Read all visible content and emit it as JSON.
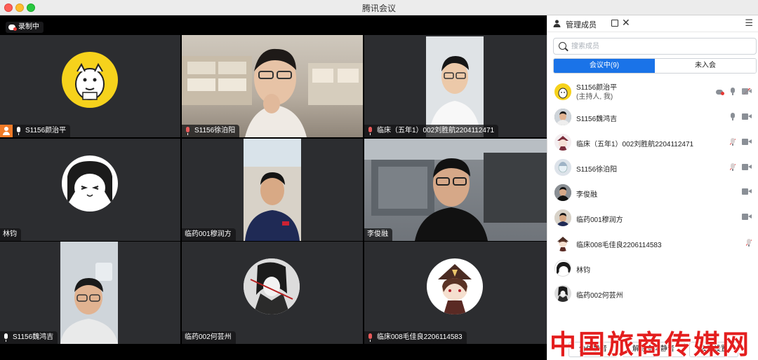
{
  "window": {
    "title": "腾讯会议"
  },
  "recording": {
    "label": "录制中"
  },
  "tiles": [
    {
      "name": "S1156颜治平",
      "host": true,
      "mic": "on"
    },
    {
      "name": "S1156徐泊阳",
      "mic": "muted"
    },
    {
      "name": "临床（五年1）002刘胜航2204112471",
      "mic": "muted"
    },
    {
      "name": "林钧"
    },
    {
      "name": "临药001穆润方"
    },
    {
      "name": "李俊融"
    },
    {
      "name": "S1156魏鸿吉",
      "mic": "on"
    },
    {
      "name": "临药002何芸州"
    },
    {
      "name": "临床008毛佳良2206114583",
      "mic": "muted"
    }
  ],
  "panel": {
    "title": "管理成员",
    "search_placeholder": "搜索成员",
    "tab_in_meeting": "会议中(9)",
    "tab_not_joined": "未入会",
    "members": [
      {
        "name": "S1156颜治平",
        "sub": "(主持人, 我)",
        "icons": [
          "cloud-record",
          "mic-on",
          "camera-off"
        ]
      },
      {
        "name": "S1156魏鸿吉",
        "icons": [
          "mic-on",
          "camera-on"
        ]
      },
      {
        "name": "临床（五年1）002刘胜航2204112471",
        "icons": [
          "mic-muted",
          "camera-on"
        ]
      },
      {
        "name": "S1156徐泊阳",
        "icons": [
          "mic-muted",
          "camera-on"
        ]
      },
      {
        "name": "李俊融",
        "icons": [
          "camera-on"
        ]
      },
      {
        "name": "临药001穆润方",
        "icons": [
          "camera-on"
        ]
      },
      {
        "name": "临床008毛佳良2206114583",
        "icons": [
          "mic-muted"
        ]
      },
      {
        "name": "林钧",
        "icons": []
      },
      {
        "name": "临药002何芸州",
        "icons": []
      }
    ],
    "footer": {
      "mute_all": "全体静音",
      "unmute_all": "解除全体静音",
      "meeting_settings": "会议设置"
    }
  },
  "watermark": "中国旅商传媒网",
  "colors": {
    "accent": "#1a73e8",
    "host_badge": "#f07a27",
    "record_red": "#e53935",
    "tile_bg": "#2c2d30"
  }
}
